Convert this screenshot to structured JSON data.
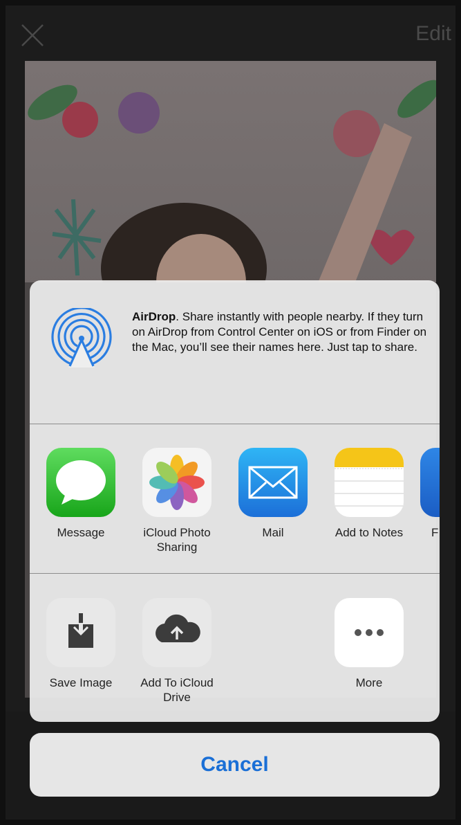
{
  "topbar": {
    "edit_label": "Edit",
    "close_icon": "close-icon"
  },
  "airdrop": {
    "title": "AirDrop",
    "text": ". Share instantly with people nearby. If they turn on AirDrop from Control Center on iOS or from Finder on the Mac, you’ll see their names here. Just tap to share.",
    "icon": "airdrop-icon"
  },
  "apps": [
    {
      "label": "Message",
      "icon": "message-icon"
    },
    {
      "label": "iCloud Photo Sharing",
      "icon": "photos-icon"
    },
    {
      "label": "Mail",
      "icon": "mail-icon"
    },
    {
      "label": "Add to Notes",
      "icon": "notes-icon"
    },
    {
      "label": "F",
      "icon": "partial-app-icon"
    }
  ],
  "actions": [
    {
      "label": "Save Image",
      "icon": "save-image-icon"
    },
    {
      "label": "Add To iCloud Drive",
      "icon": "icloud-drive-icon"
    },
    {
      "label": "More",
      "icon": "more-icon"
    }
  ],
  "cancel_label": "Cancel",
  "colors": {
    "accent": "#1a6fd6",
    "airdrop_blue": "#2a7de1",
    "message_green": "#18a51a",
    "notes_yellow": "#f5c518"
  }
}
